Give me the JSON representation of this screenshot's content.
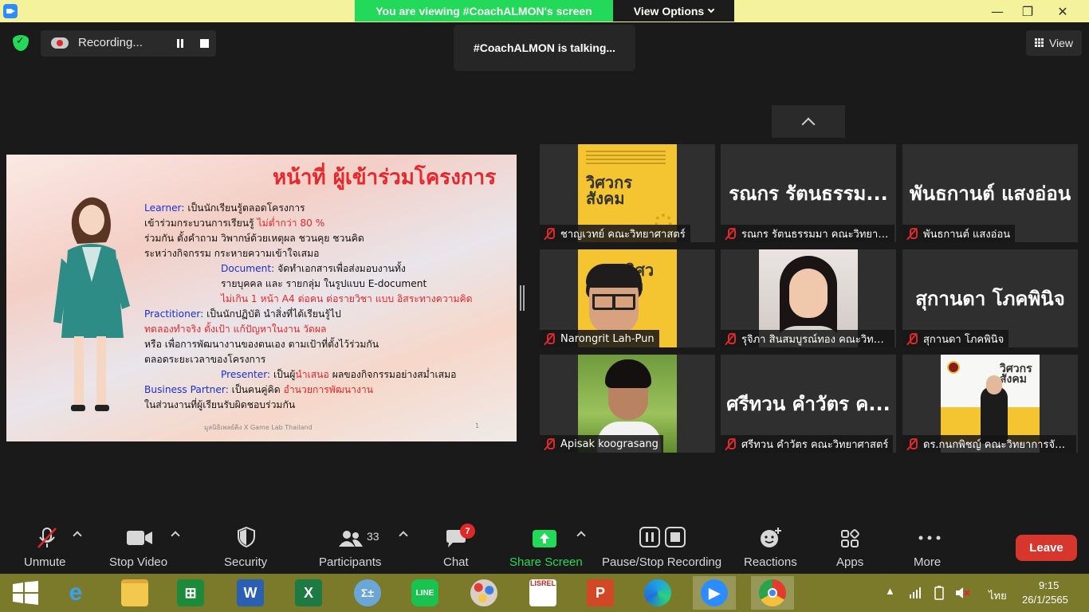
{
  "window": {
    "viewing_banner": "You are viewing #CoachALMON's screen",
    "view_options": "View Options",
    "controls": [
      "—",
      "❐",
      "✕"
    ]
  },
  "meeting": {
    "recording_label": "Recording...",
    "talking": "#CoachALMON is talking...",
    "view_button": "View"
  },
  "slide": {
    "title": "หน้าที่ ผู้เข้าร่วมโครงการ",
    "lines": [
      {
        "segments": [
          {
            "text": "Learner:",
            "style": "blue"
          },
          {
            "text": " เป็นนักเรียนรู้ตลอดโครงการ",
            "style": ""
          }
        ]
      },
      {
        "segments": [
          {
            "text": "เข้าร่วมกระบวนการเรียนรู้ ",
            "style": ""
          },
          {
            "text": "ไม่ต่ำกว่า 80 %",
            "style": "red"
          }
        ]
      },
      {
        "segments": [
          {
            "text": "ร่วมกัน ตั้งคำถาม วิพากษ์ด้วยเหตุผล ชวนคุย ชวนคิด",
            "style": ""
          }
        ]
      },
      {
        "segments": [
          {
            "text": "ระหว่างกิจกรรม กระหายความเข้าใจเสมอ",
            "style": ""
          }
        ]
      },
      {
        "segments": [
          {
            "text": "Document:",
            "style": "blue"
          },
          {
            "text": " จัดทำเอกสารเพื่อส่งมอบงานทั้ง",
            "style": ""
          }
        ]
      },
      {
        "segments": [
          {
            "text": "รายบุคคล และ รายกลุ่ม ในรูปแบบ E-document",
            "style": ""
          }
        ]
      },
      {
        "segments": [
          {
            "text": "ไม่เกิน 1 หน้า A4 ต่อคน ต่อรายวิชา แบบ อิสระทางความคิด",
            "style": "red"
          }
        ]
      },
      {
        "segments": [
          {
            "text": "Practitioner:",
            "style": "blue"
          },
          {
            "text": " เป็นนักปฏิบัติ นำสิ่งที่ได้เรียนรู้ไป",
            "style": ""
          }
        ]
      },
      {
        "segments": [
          {
            "text": "ทดลองทำจริง ตั้งเป้า แก้ปัญหาในงาน วัดผล",
            "style": "red"
          }
        ]
      },
      {
        "segments": [
          {
            "text": "หรือ เพื่อการพัฒนางานของตนเอง ตามเป้าที่ตั้งไว้ร่วมกัน",
            "style": ""
          }
        ]
      },
      {
        "segments": [
          {
            "text": "ตลอดระยะเวลาของโครงการ",
            "style": ""
          }
        ]
      },
      {
        "segments": [
          {
            "text": "Presenter:",
            "style": "blue"
          },
          {
            "text": " เป็นผู้",
            "style": ""
          },
          {
            "text": "นำเสนอ",
            "style": "red"
          },
          {
            "text": " ผลของกิจกรรมอย่างสม่ำเสมอ",
            "style": ""
          }
        ]
      },
      {
        "segments": [
          {
            "text": "Business Partner:",
            "style": "blue"
          },
          {
            "text": " เป็นคนคู่คิด ",
            "style": ""
          },
          {
            "text": "อำนวยการพัฒนางาน",
            "style": "red"
          }
        ]
      },
      {
        "segments": [
          {
            "text": "ในส่วนงานที่ผู้เรียนรับผิดชอบร่วมกัน",
            "style": ""
          }
        ]
      }
    ],
    "footer": "มูลนิธิเพลย์คิง X Game Lab Thailand",
    "page_number": "1"
  },
  "participants": [
    {
      "label": "ชาญเวทย์ คณะวิทยาศาสตร์",
      "display": "book",
      "book_title": "วิศวกร\nสังคม",
      "big_name": ""
    },
    {
      "label": "รณกร รัตนธรรมมา คณะวิทยาศาสตร์",
      "display": "name",
      "big_name": "รณกร รัตนธรรม..."
    },
    {
      "label": "พันธกานต์ แสงอ่อน",
      "display": "name",
      "big_name": "พันธกานต์ แสงอ่อน"
    },
    {
      "label": "Narongrit Lah-Pun",
      "display": "cartoon",
      "book_title": "วิศว\nสัง",
      "big_name": ""
    },
    {
      "label": "รุจิภา สินสมบูรณ์ทอง คณะวิทยาศาสตร์",
      "display": "girl",
      "big_name": ""
    },
    {
      "label": "สุกานดา โภคพินิจ",
      "display": "name",
      "big_name": "สุกานดา โภคพินิจ"
    },
    {
      "label": "Apisak koograsang",
      "display": "guy",
      "big_name": ""
    },
    {
      "label": "ศรีทวน คำวัตร คณะวิทยาศาสตร์",
      "display": "name",
      "big_name": "ศรีทวน คำวัตร ค..."
    },
    {
      "label": "ดร.กนกพิชญ์ คณะวิทยาการจัดการ",
      "display": "card",
      "book_title": "วิศวกร\nสังคม",
      "big_name": ""
    }
  ],
  "toolbar": {
    "unmute": "Unmute",
    "stop_video": "Stop Video",
    "security": "Security",
    "participants": "Participants",
    "participants_count": "33",
    "chat": "Chat",
    "chat_badge": "7",
    "share_screen": "Share Screen",
    "pause_stop_recording": "Pause/Stop Recording",
    "reactions": "Reactions",
    "apps": "Apps",
    "more": "More",
    "leave": "Leave"
  },
  "taskbar": {
    "apps": [
      {
        "name": "start-button",
        "icon": "windows-logo-icon"
      },
      {
        "name": "internet-explorer",
        "icon": "ie-icon"
      },
      {
        "name": "file-explorer",
        "icon": "folder-icon"
      },
      {
        "name": "microsoft-store",
        "icon": "store-icon"
      },
      {
        "name": "word",
        "icon": "word-icon"
      },
      {
        "name": "excel",
        "icon": "excel-icon"
      },
      {
        "name": "math-input",
        "icon": "math-icon"
      },
      {
        "name": "line",
        "icon": "line-icon"
      },
      {
        "name": "paint",
        "icon": "paint-icon"
      },
      {
        "name": "lisrel",
        "icon": "lisrel-icon"
      },
      {
        "name": "powerpoint",
        "icon": "powerpoint-icon"
      },
      {
        "name": "edge",
        "icon": "edge-icon"
      },
      {
        "name": "zoom",
        "icon": "zoom-icon"
      },
      {
        "name": "chrome",
        "icon": "chrome-icon"
      }
    ],
    "lisrel_text": "LISREL",
    "language": "ไทย",
    "time": "9:15",
    "date": "26/1/2565"
  },
  "colors": {
    "titlebar": "#f4f39b",
    "banner_green": "#23d959",
    "leave_red": "#d6362b",
    "taskbar": "#7a7a2a",
    "slide_blue": "#1a2fd6",
    "slide_red": "#e8262b",
    "mute_red": "#e02828"
  }
}
